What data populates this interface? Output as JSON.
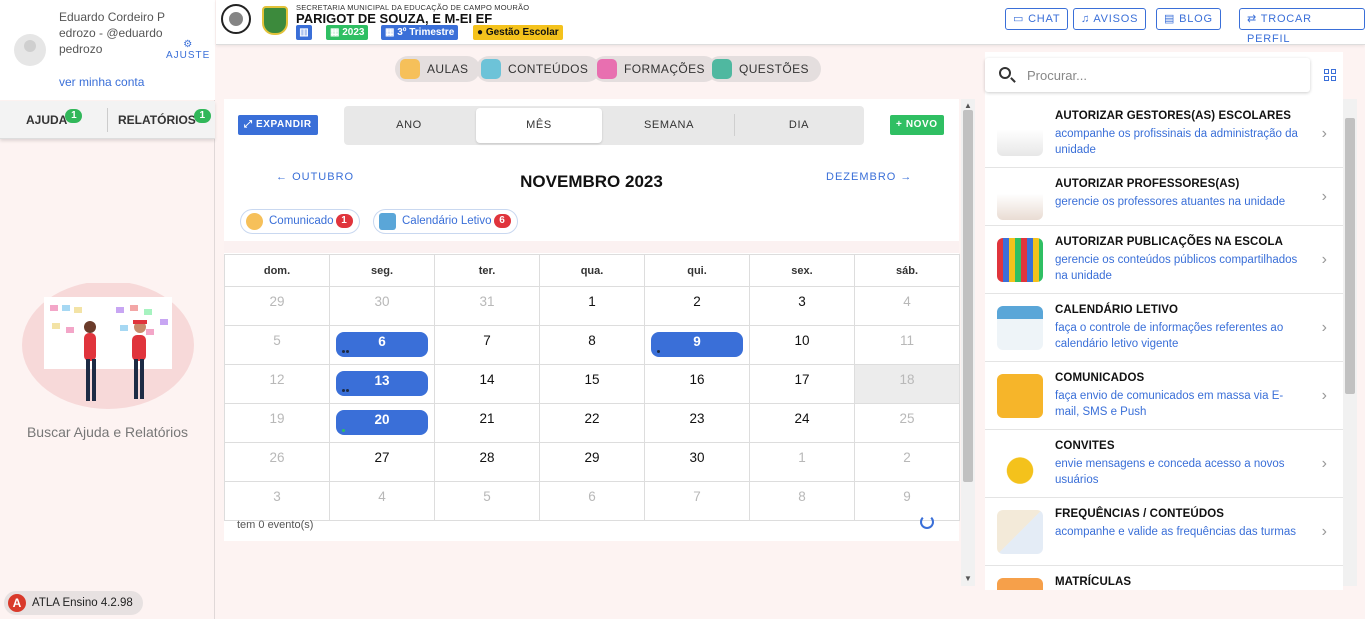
{
  "user": {
    "name": "Eduardo Cordeiro Pedrozo - @eduardopedrozo",
    "view_account": "ver minha conta",
    "settings_label": "AJUSTE"
  },
  "left_tabs": [
    {
      "label": "AJUDA",
      "badge": "1"
    },
    {
      "label": "RELATÓRIOS",
      "badge": "1"
    }
  ],
  "help_text": "Buscar Ajuda e Relatórios",
  "app_version": "ATLA Ensino 4.2.98",
  "header": {
    "secretaria": "SECRETARIA MUNICIPAL DA EDUCAÇÃO DE CAMPO MOURÃO",
    "school": "PARIGOT DE SOUZA, E M-EI EF",
    "chips": [
      "2023",
      "3º Trimestre",
      "Gestão Escolar"
    ],
    "buttons": [
      "CHAT",
      "AVISOS",
      "BLOG",
      "TROCAR PERFIL"
    ]
  },
  "modules": [
    "AULAS",
    "CONTEÚDOS",
    "FORMAÇÕES",
    "QUESTÕES"
  ],
  "calendar": {
    "expand_label": "EXPANDIR",
    "new_label": "NOVO",
    "views": [
      "ANO",
      "MÊS",
      "SEMANA",
      "DIA"
    ],
    "active_view": "MÊS",
    "prev_month": "OUTUBRO",
    "next_month": "DEZEMBRO",
    "title": "NOVEMBRO 2023",
    "legend": [
      {
        "label": "Comunicado",
        "count": "1"
      },
      {
        "label": "Calendário Letivo",
        "count": "6"
      }
    ],
    "weekdays": [
      "dom.",
      "seg.",
      "ter.",
      "qua.",
      "qui.",
      "sex.",
      "sáb."
    ],
    "weeks": [
      [
        "29",
        "30",
        "31",
        "1",
        "2",
        "3",
        "4"
      ],
      [
        "5",
        "6",
        "7",
        "8",
        "9",
        "10",
        "11"
      ],
      [
        "12",
        "13",
        "14",
        "15",
        "16",
        "17",
        "18"
      ],
      [
        "19",
        "20",
        "21",
        "22",
        "23",
        "24",
        "25"
      ],
      [
        "26",
        "27",
        "28",
        "29",
        "30",
        "1",
        "2"
      ],
      [
        "3",
        "4",
        "5",
        "6",
        "7",
        "8",
        "9"
      ]
    ],
    "events_count_text": "tem 0 evento(s)"
  },
  "search": {
    "placeholder": "Procurar..."
  },
  "menu_items": [
    {
      "title": "AUTORIZAR GESTORES(AS) ESCOLARES",
      "desc": "acompanhe os profissinais da administração da unidade"
    },
    {
      "title": "AUTORIZAR PROFESSORES(AS)",
      "desc": "gerencie os professores atuantes na unidade"
    },
    {
      "title": "AUTORIZAR PUBLICAÇÕES NA ESCOLA",
      "desc": "gerencie os conteúdos públicos compartilhados na unidade"
    },
    {
      "title": "CALENDÁRIO LETIVO",
      "desc": "faça o controle de informações referentes ao calendário letivo vigente"
    },
    {
      "title": "COMUNICADOS",
      "desc": "faça envio de comunicados em massa via E-mail, SMS e Push"
    },
    {
      "title": "CONVITES",
      "desc": "envie mensagens e conceda acesso a novos usuários"
    },
    {
      "title": "FREQUÊNCIAS / CONTEÚDOS",
      "desc": "acompanhe e valide as frequências das turmas"
    },
    {
      "title": "MATRÍCULAS",
      "desc": ""
    }
  ],
  "colors": {
    "accent": "#3a6fd8",
    "success": "#2fbf63",
    "danger": "#e0343c",
    "background": "#fdf3f2"
  }
}
